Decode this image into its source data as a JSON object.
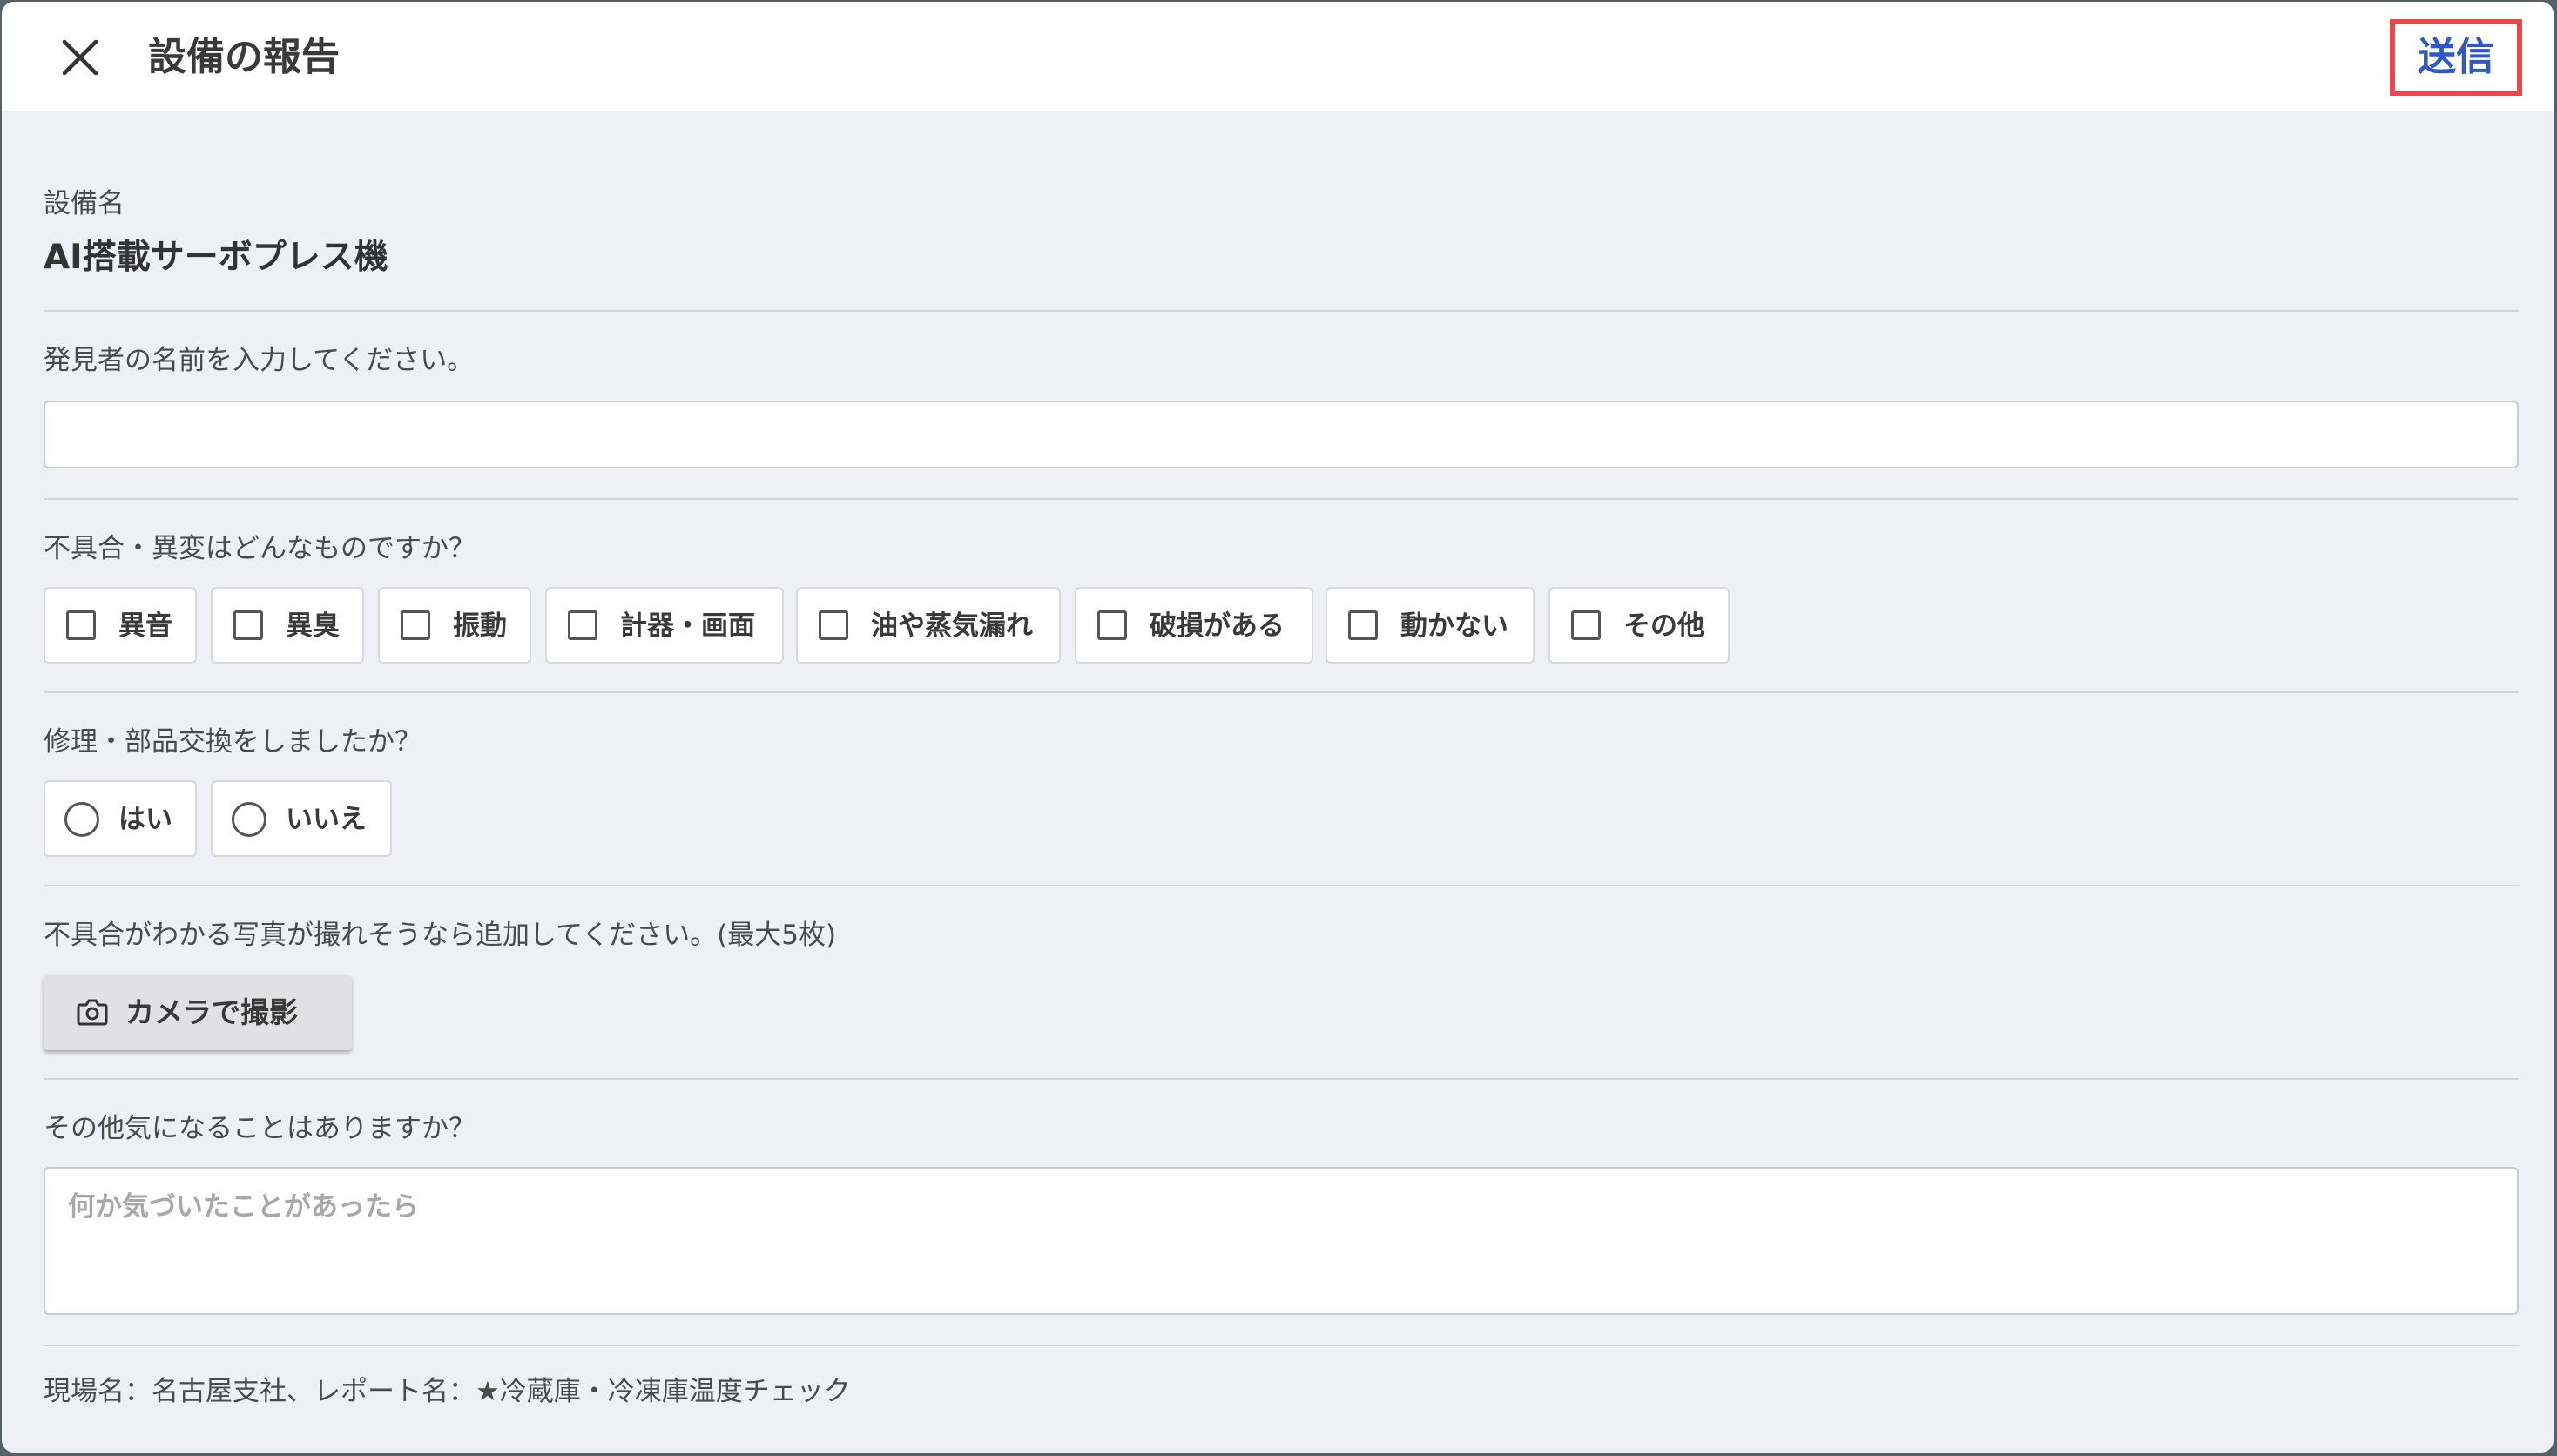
{
  "header": {
    "title": "設備の報告",
    "send_label": "送信",
    "close_icon": "close-icon",
    "accent_color": "#2f57cc",
    "highlight_color": "#e8474c"
  },
  "equipment": {
    "label": "設備名",
    "name": "AI搭載サーボプレス機"
  },
  "discoverer": {
    "label": "発見者の名前を入力してください。",
    "value": "",
    "placeholder": ""
  },
  "issues": {
    "label": "不具合・異変はどんなものですか？",
    "options": [
      {
        "label": "異音",
        "checked": false
      },
      {
        "label": "異臭",
        "checked": false
      },
      {
        "label": "振動",
        "checked": false
      },
      {
        "label": "計器・画面",
        "checked": false
      },
      {
        "label": "油や蒸気漏れ",
        "checked": false
      },
      {
        "label": "破損がある",
        "checked": false
      },
      {
        "label": "動かない",
        "checked": false
      },
      {
        "label": "その他",
        "checked": false
      }
    ]
  },
  "repair": {
    "label": "修理・部品交換をしましたか？",
    "options": [
      {
        "label": "はい",
        "selected": false
      },
      {
        "label": "いいえ",
        "selected": false
      }
    ]
  },
  "photos": {
    "label": "不具合がわかる写真が撮れそうなら追加してください。(最大5枚)",
    "camera_label": "カメラで撮影",
    "camera_icon": "camera-icon"
  },
  "notes": {
    "label": "その他気になることはありますか？",
    "value": "",
    "placeholder": "何か気づいたことがあったら"
  },
  "footer": {
    "text": "現場名：名古屋支社、レポート名：★冷蔵庫・冷凍庫温度チェック"
  }
}
